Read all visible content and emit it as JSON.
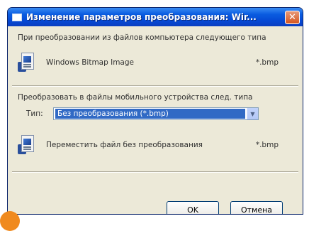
{
  "window": {
    "title": "Изменение параметров преобразования: Wir..."
  },
  "source_section": {
    "caption": "При преобразовании из файлов компьютера следующего типа",
    "file_type_name": "Windows Bitmap Image",
    "extension": "*.bmp"
  },
  "target_section": {
    "caption": "Преобразовать в файлы мобильного устройства след. типа",
    "type_label": "Тип:",
    "type_selected": "Без преобразования (*.bmp)",
    "result_text": "Переместить файл без преобразования",
    "result_extension": "*.bmp"
  },
  "buttons": {
    "ok": "OK",
    "cancel": "Отмена"
  },
  "icons": {
    "title": "window-app-icon",
    "source": "bitmap-file-icon",
    "target": "bitmap-file-icon",
    "close": "close-icon",
    "dropdown": "chevron-down-icon"
  },
  "colors": {
    "title_bar": "#0a5ce0",
    "close_button": "#d5561f",
    "selection": "#316ac5",
    "dialog_bg": "#ece9d8",
    "marker": "#f08a1e"
  }
}
